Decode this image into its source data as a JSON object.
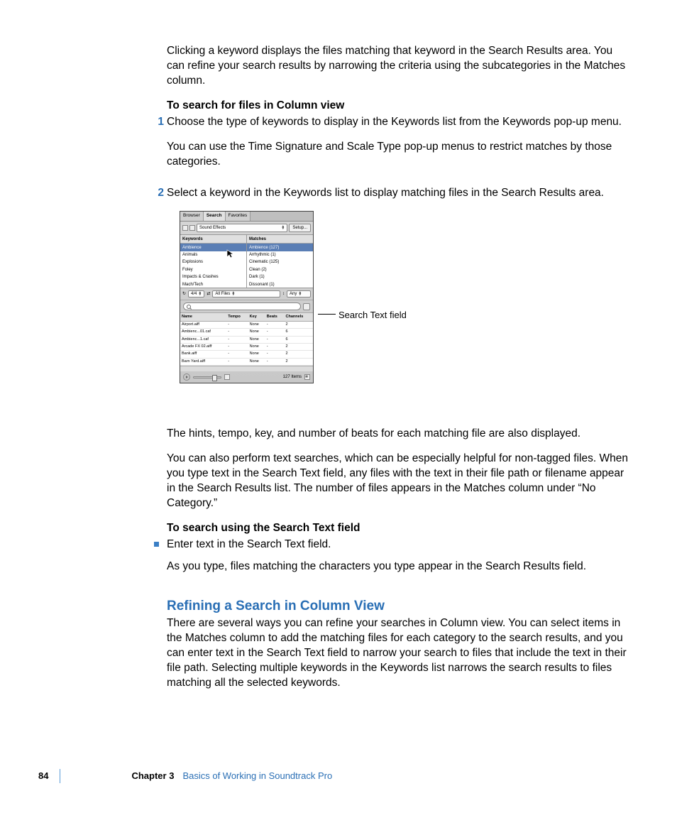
{
  "body": {
    "p1": "Clicking a keyword displays the files matching that keyword in the Search Results area. You can refine your search results by narrowing the criteria using the subcategories in the Matches column.",
    "h_search_column": "To search for files in Column view",
    "step1": "Choose the type of keywords to display in the Keywords list from the Keywords pop-up menu.",
    "step1b": "You can use the Time Signature and Scale Type pop-up menus to restrict matches by those categories.",
    "step2": "Select a keyword in the Keywords list to display matching files in the Search Results area.",
    "p_after_ss": "The hints, tempo, key, and number of beats for each matching file are also displayed.",
    "p_textsearch": "You can also perform text searches, which can be especially helpful for non-tagged files. When you type text in the Search Text field, any files with the text in their file path or filename appear in the Search Results list. The number of files appears in the Matches column under “No Category.”",
    "h_search_text": "To search using the Search Text field",
    "bullet1": "Enter text in the Search Text field.",
    "bullet1b": "As you type, files matching the characters you type appear in the Search Results field.",
    "h_refining": "Refining a Search in Column View",
    "p_refining": "There are several ways you can refine your searches in Column view. You can select items in the Matches column to add the matching files for each category to the search results, and you can enter text in the Search Text field to narrow your search to files that include the text in their file path. Selecting multiple keywords in the Keywords list narrows the search results to files matching all the selected keywords."
  },
  "step_labels": {
    "one": "1",
    "two": "2"
  },
  "callout": {
    "search_text_field": "Search Text field"
  },
  "footer": {
    "page": "84",
    "chapter": "Chapter 3",
    "title": "Basics of Working in Soundtrack Pro"
  },
  "ss": {
    "tabs": {
      "browser": "Browser",
      "search": "Search",
      "favorites": "Favorites"
    },
    "category_popup": "Sound Effects",
    "setup": "Setup...",
    "col_keywords": "Keywords",
    "col_matches": "Matches",
    "keywords": [
      "Ambience",
      "Animals",
      "Explosions",
      "Foley",
      "Impacts & Crashes",
      "Mach/Tech"
    ],
    "matches": [
      "Ambience (127)",
      "Arrhythmic (1)",
      "Cinematic (125)",
      "Clean (2)",
      "Dark (1)",
      "Dissonant (1)"
    ],
    "timesig": "4/4",
    "filetype": "All Files",
    "scale": "Any",
    "table": {
      "headers": [
        "Name",
        "Tempo",
        "Key",
        "Beats",
        "Channels"
      ],
      "rows": [
        [
          "Airport.aiff",
          "-",
          "None",
          "-",
          "2"
        ],
        [
          "Ambienc...01.caf",
          "-",
          "None",
          "-",
          "6"
        ],
        [
          "Ambienc...1.caf",
          "-",
          "None",
          "-",
          "6"
        ],
        [
          "Arcade FX 02.aiff",
          "-",
          "None",
          "-",
          "2"
        ],
        [
          "Bank.aiff",
          "-",
          "None",
          "-",
          "2"
        ],
        [
          "Barn Yard.aiff",
          "-",
          "None",
          "-",
          "2"
        ]
      ]
    },
    "items_count": "127 Items"
  }
}
